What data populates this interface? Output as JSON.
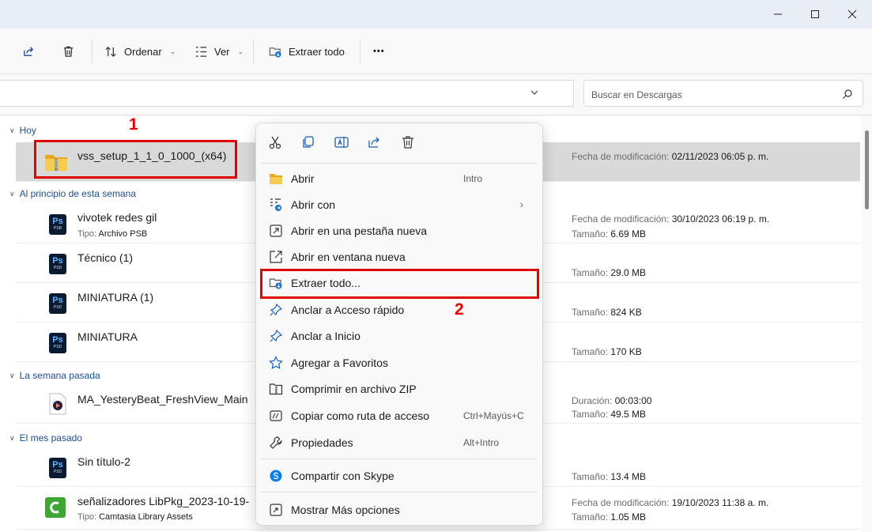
{
  "window": {
    "minimize_glyph": "—",
    "maximize_glyph": "☐",
    "close_glyph": "✕"
  },
  "toolbar": {
    "sort_label": "Ordenar",
    "view_label": "Ver",
    "extract_label": "Extraer todo",
    "more_label": "•••"
  },
  "search": {
    "placeholder": "Buscar en Descargas"
  },
  "groups": {
    "today": "Hoy",
    "this_week": "Al principio de esta semana",
    "last_week": "La semana pasada",
    "last_month": "El mes pasado"
  },
  "files": [
    {
      "name": "vss_setup_1_1_0_1000_(x64)",
      "meta1_key": "Fecha de modificación:",
      "meta1_val": "02/11/2023 06:05 p. m."
    },
    {
      "name": "vivotek redes gil",
      "sub_key": "Tipo:",
      "sub_val": "Archivo PSB",
      "icon_text": "PSB",
      "meta1_key": "Fecha de modificación:",
      "meta1_val": "30/10/2023 06:19 p. m.",
      "meta2_key": "Tamaño:",
      "meta2_val": "6.69 MB"
    },
    {
      "name": "Técnico (1)",
      "icon_text": "PSD",
      "meta2_key": "Tamaño:",
      "meta2_val": "29.0 MB"
    },
    {
      "name": "MINIATURA (1)",
      "icon_text": "PSD",
      "meta2_key": "Tamaño:",
      "meta2_val": "824 KB"
    },
    {
      "name": "MINIATURA",
      "icon_text": "PSD",
      "meta2_key": "Tamaño:",
      "meta2_val": "170 KB"
    },
    {
      "name": "MA_YesteryBeat_FreshView_Main",
      "meta1_key": "Duración:",
      "meta1_val": "00:03:00",
      "meta2_key": "Tamaño:",
      "meta2_val": "49.5 MB"
    },
    {
      "name": "Sin título-2",
      "icon_text": "PSD",
      "meta2_key": "Tamaño:",
      "meta2_val": "13.4 MB"
    },
    {
      "name": "señalizadores LibPkg_2023-10-19-",
      "sub_key": "Tipo:",
      "sub_val": "Camtasia Library Assets",
      "meta1_key": "Fecha de modificación:",
      "meta1_val": "19/10/2023 11:38 a. m.",
      "meta2_key": "Tamaño:",
      "meta2_val": "1.05 MB"
    }
  ],
  "ps_icon_glyph": "Ps",
  "context_menu": {
    "items": [
      {
        "label": "Abrir",
        "shortcut": "Intro"
      },
      {
        "label": "Abrir con",
        "arrow": "›"
      },
      {
        "label": "Abrir en una pestaña nueva"
      },
      {
        "label": "Abrir en ventana nueva"
      },
      {
        "label": "Extraer todo..."
      },
      {
        "label": "Anclar a Acceso rápido"
      },
      {
        "label": "Anclar a Inicio"
      },
      {
        "label": "Agregar a Favoritos"
      },
      {
        "label": "Comprimir en archivo ZIP"
      },
      {
        "label": "Copiar como ruta de acceso",
        "shortcut": "Ctrl+Mayús+C"
      },
      {
        "label": "Propiedades",
        "shortcut": "Alt+Intro"
      },
      {
        "label": "Compartir con Skype"
      },
      {
        "label": "Mostrar Más opciones"
      }
    ]
  },
  "annotations": {
    "step1": "1",
    "step2": "2"
  },
  "colors": {
    "annotation_red": "#e00000",
    "selected_row": "#d9d9d9",
    "group_blue": "#1f4e8c"
  }
}
